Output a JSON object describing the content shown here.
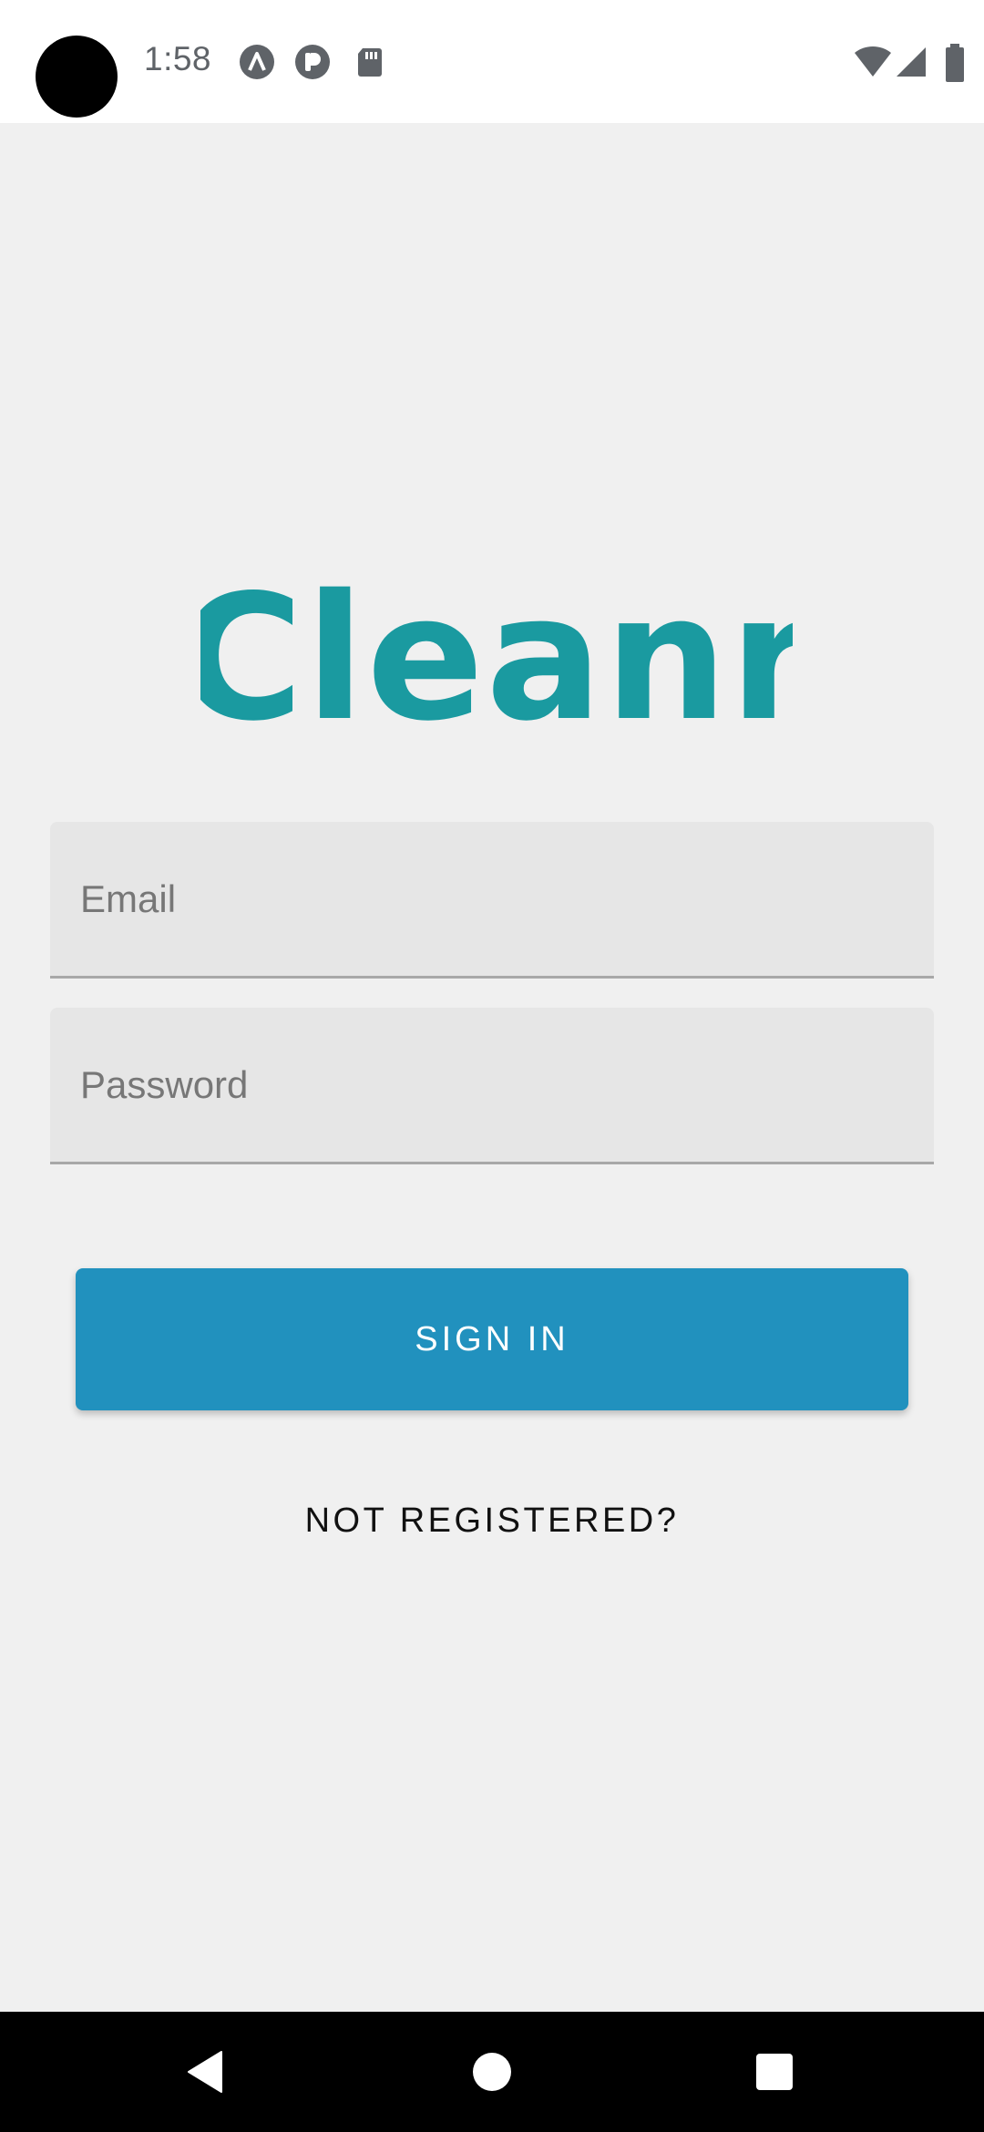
{
  "status_bar": {
    "time": "1:58",
    "left_icons": [
      "notification-a-icon",
      "notification-p-icon",
      "sd-card-icon"
    ],
    "right_icons": [
      "wifi-icon",
      "cell-signal-icon",
      "battery-icon"
    ]
  },
  "app": {
    "logo_text": "Cleanr",
    "brand_color": "#1a9aa0"
  },
  "form": {
    "email_placeholder": "Email",
    "password_placeholder": "Password",
    "signin_label": "SIGN IN",
    "not_registered_label": "NOT REGISTERED?"
  },
  "colors": {
    "button": "#2191be",
    "background": "#f0f0f0",
    "field": "#e6e6e6"
  },
  "nav_bar": {
    "buttons": [
      "back-icon",
      "home-icon",
      "recents-icon"
    ]
  }
}
